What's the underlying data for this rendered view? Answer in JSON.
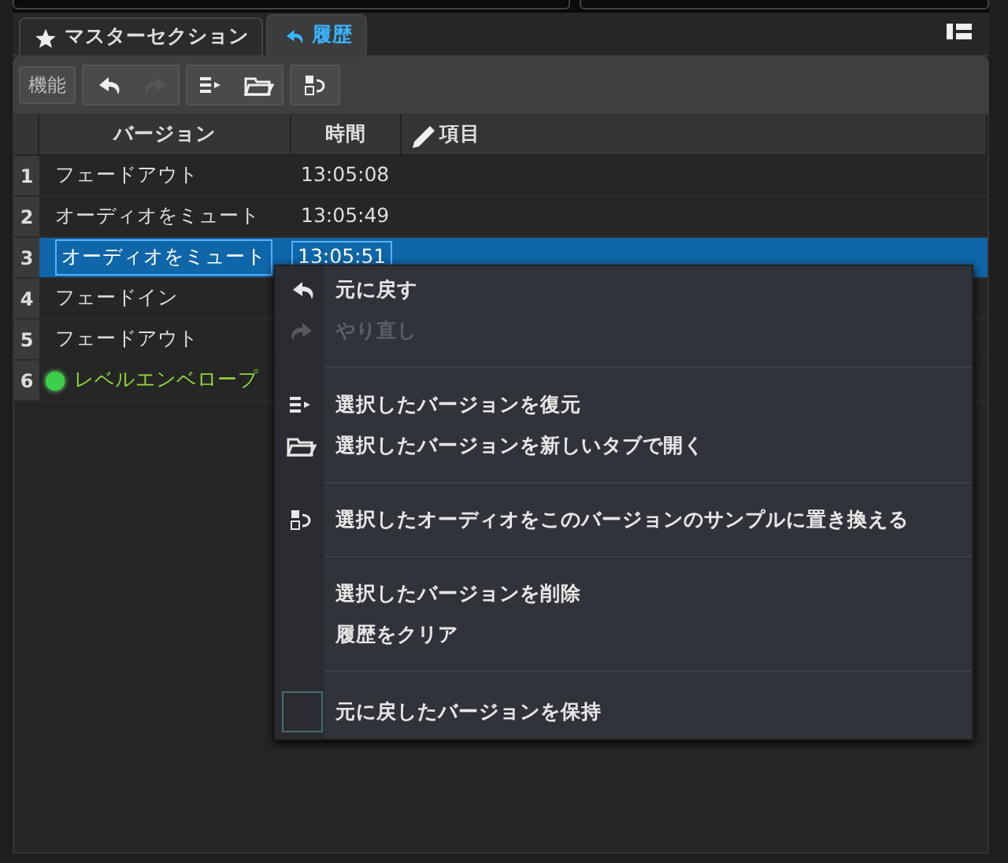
{
  "tabs": [
    {
      "label": "マスターセクション",
      "kind": "star",
      "selected": false
    },
    {
      "label": "履歴",
      "kind": "history",
      "selected": true
    }
  ],
  "toolbar": {
    "function_button": "機能",
    "tools": [
      {
        "kind": "undo",
        "disabled": false
      },
      {
        "kind": "redo",
        "disabled": true
      },
      {
        "kind": "restore",
        "disabled": false
      },
      {
        "kind": "open",
        "disabled": false
      },
      {
        "kind": "replace",
        "disabled": false
      }
    ]
  },
  "table": {
    "columns": [
      {
        "label": "バージョン",
        "kind": "plain"
      },
      {
        "label": "時間",
        "kind": "plain"
      },
      {
        "label": "項目",
        "kind": "pencil"
      }
    ],
    "rows": [
      {
        "number": "1",
        "version": "フェードアウト",
        "time": "13:05:08",
        "selected": false,
        "current": false
      },
      {
        "number": "2",
        "version": "オーディオをミュート",
        "time": "13:05:49",
        "selected": false,
        "current": false
      },
      {
        "number": "3",
        "version": "オーディオをミュート",
        "time": "13:05:51",
        "selected": true,
        "current": false
      },
      {
        "number": "4",
        "version": "フェードイン",
        "selected": false,
        "current": false
      },
      {
        "number": "5",
        "version": "フェードアウト",
        "selected": false,
        "current": false
      },
      {
        "number": "6",
        "version": "レベルエンベロープ",
        "selected": false,
        "current": true
      }
    ]
  },
  "context_menu": [
    {
      "kind": "undo",
      "label": "元に戻す",
      "disabled": false
    },
    {
      "kind": "redo",
      "label": "やり直し",
      "disabled": true
    },
    {
      "kind": "separator"
    },
    {
      "kind": "restore",
      "label": "選択したバージョンを復元",
      "disabled": false
    },
    {
      "kind": "open",
      "label": "選択したバージョンを新しいタブで開く",
      "disabled": false
    },
    {
      "kind": "separator"
    },
    {
      "kind": "replace",
      "label": "選択したオーディオをこのバージョンのサンプルに置き換える",
      "disabled": false
    },
    {
      "kind": "separator"
    },
    {
      "kind": "plain",
      "label": "選択したバージョンを削除",
      "disabled": false
    },
    {
      "kind": "plain",
      "label": "履歴をクリア",
      "disabled": false
    },
    {
      "kind": "separator"
    },
    {
      "kind": "check",
      "label": "元に戻したバージョンを保持",
      "checked": false
    }
  ]
}
